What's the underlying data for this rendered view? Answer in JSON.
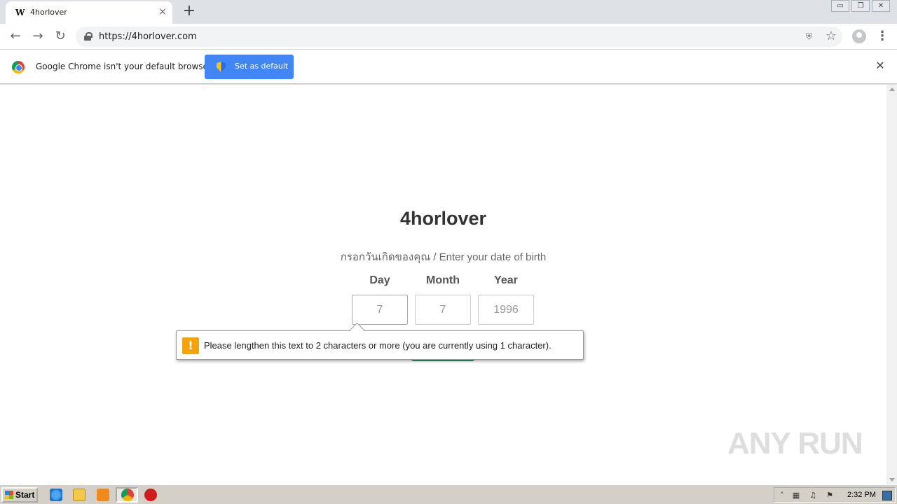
{
  "browser": {
    "tab_title": "4horlover",
    "tab_favicon": "W",
    "new_tab_symbol": "+",
    "tab_close_symbol": "×",
    "url": "https://4horlover.com",
    "window_buttons": [
      "▭",
      "❐",
      "✕"
    ]
  },
  "infobar": {
    "message": "Google Chrome isn't your default browser",
    "button_label": "Set as default",
    "close_symbol": "✕"
  },
  "page": {
    "title": "4horlover",
    "subtitle": "กรอกวันเกิดของคุณ / Enter your date of birth",
    "fields": [
      {
        "label": "Day",
        "value": "7"
      },
      {
        "label": "Month",
        "value": "7"
      },
      {
        "label": "Year",
        "value": "1996"
      }
    ],
    "validation_message": "Please lengthen this text to 2 characters or more (you are currently using 1 character).",
    "validation_icon": "!",
    "watermark": "ANY RUN"
  },
  "taskbar": {
    "start_label": "Start",
    "clock": "2:32 PM"
  },
  "colors": {
    "accent_blue": "#4285f4",
    "warning_orange": "#f4a30a",
    "submit_green": "#2e9c5f"
  }
}
